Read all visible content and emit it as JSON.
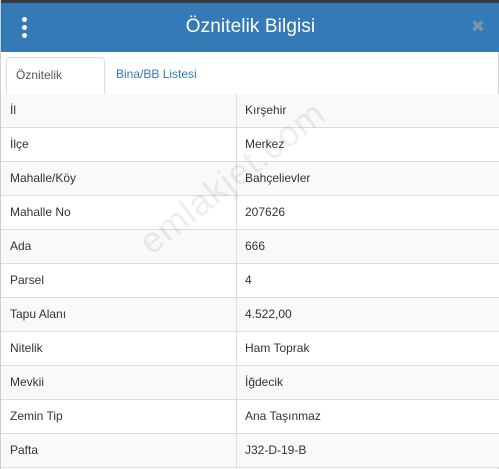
{
  "header": {
    "title": "Öznitelik Bilgisi",
    "close_glyph": "✖",
    "menu_icon": "vertical-dots-icon"
  },
  "tabs": [
    {
      "label": "Öznitelik Bilgisi",
      "active": true
    },
    {
      "label": "Bina/BB Listesi",
      "active": false
    }
  ],
  "rows": [
    {
      "label": "İl",
      "value": "Kırşehir"
    },
    {
      "label": "İlçe",
      "value": "Merkez"
    },
    {
      "label": "Mahalle/Köy",
      "value": "Bahçelievler"
    },
    {
      "label": "Mahalle No",
      "value": "207626"
    },
    {
      "label": "Ada",
      "value": "666"
    },
    {
      "label": "Parsel",
      "value": "4"
    },
    {
      "label": "Tapu Alanı",
      "value": "4.522,00"
    },
    {
      "label": "Nitelik",
      "value": "Ham Toprak"
    },
    {
      "label": "Mevkii",
      "value": "İğdecik"
    },
    {
      "label": "Zemin Tip",
      "value": "Ana Taşınmaz"
    },
    {
      "label": "Pafta",
      "value": "J32-D-19-B"
    }
  ],
  "watermark": "emlakjet.com",
  "colors": {
    "header_bg": "#337ab7",
    "link": "#337ab7",
    "stripe": "#f9f9f9",
    "border": "#dddddd"
  }
}
